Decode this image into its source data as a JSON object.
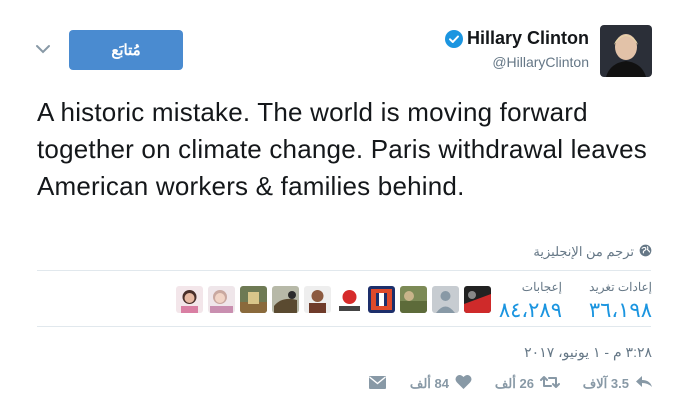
{
  "header": {
    "display_name": "Hillary Clinton",
    "handle": "@HillaryClinton",
    "follow_label": "مُتابَع"
  },
  "tweet": {
    "text": "A historic mistake. The world is moving forward together on climate change. Paris withdrawal leaves American workers & families behind.",
    "translate_label": "ترجم من الإنجليزية"
  },
  "stats": {
    "retweets_label": "إعادات تغريد",
    "retweets_value": "٣٦،١٩٨",
    "likes_label": "إعجابات",
    "likes_value": "٨٤،٢٨٩"
  },
  "timestamp": "٣:٢٨ م - ١ يونيو، ٢٠١٧",
  "actions": {
    "reply_count": "3.5 آلاف",
    "retweet_count": "26 ألف",
    "like_count": "84 ألف"
  },
  "colors": {
    "accent": "#1b95e0",
    "follow_button": "#4a8bd0",
    "muted": "#657786",
    "icon": "#8899a6"
  },
  "likers": [
    "liker-1",
    "liker-2",
    "liker-3",
    "liker-4",
    "liker-5",
    "liker-6",
    "liker-7",
    "liker-8",
    "liker-9"
  ]
}
